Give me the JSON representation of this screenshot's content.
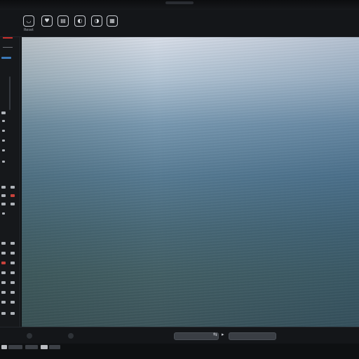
{
  "toolbar": {
    "items": [
      {
        "label": "Reset",
        "icon": "shield-icon",
        "glyph": "◡"
      },
      {
        "label": "",
        "icon": "badge-icon",
        "glyph": "♥"
      },
      {
        "label": "",
        "icon": "document-icon",
        "glyph": "▤"
      },
      {
        "label": "",
        "icon": "exposure-icon",
        "glyph": "◐"
      },
      {
        "label": "",
        "icon": "color-icon",
        "glyph": "◑"
      },
      {
        "label": "",
        "icon": "crop-icon",
        "glyph": "▦"
      }
    ]
  },
  "status": {
    "zoom_text": "",
    "field_left": "",
    "field_right": ""
  },
  "colors": {
    "accent": "#3b79b8",
    "highlight": "#c8423b",
    "background": "#131518"
  }
}
